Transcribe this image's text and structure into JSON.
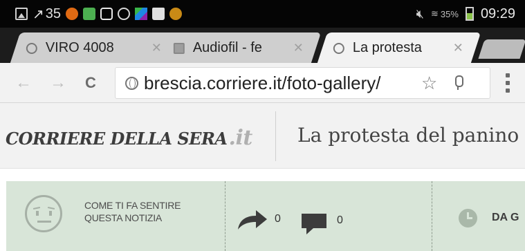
{
  "status_bar": {
    "temperature": "35",
    "battery": "35%",
    "time": "09:29",
    "icons": [
      "picture-icon",
      "temperature-icon",
      "orange-app-icon",
      "message-icon",
      "box-app-icon",
      "clock-app-icon",
      "multicolor-app-icon",
      "shopping-bag-icon",
      "gold-app-icon",
      "mute-icon",
      "wifi-signal-icon",
      "battery-icon"
    ]
  },
  "tabs": [
    {
      "title": "VIRO 4008",
      "icon": "globe-icon",
      "active": false
    },
    {
      "title": "Audiofil - fe",
      "icon": "audiofil-icon",
      "active": false
    },
    {
      "title": "La protesta",
      "icon": "globe-icon",
      "active": true
    }
  ],
  "toolbar": {
    "url": "brescia.corriere.it/foto-gallery/"
  },
  "header": {
    "logo_text": "CORRIERE DELLA SERA",
    "logo_suffix": ".it",
    "headline": "La protesta del panino"
  },
  "feelings": {
    "line1": "COME TI FA SENTIRE",
    "line2": "QUESTA NOTIZIA",
    "share_count": "0",
    "comment_count": "0",
    "time_label": "DA G"
  }
}
